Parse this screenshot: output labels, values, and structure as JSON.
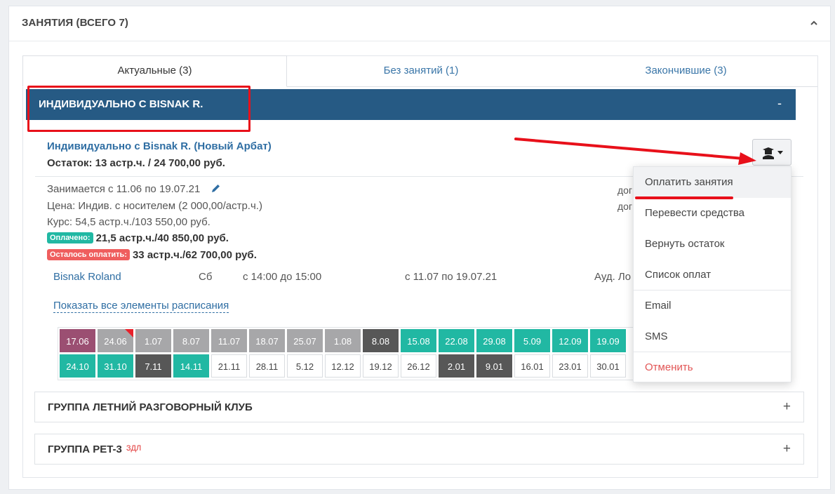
{
  "panel": {
    "title": "ЗАНЯТИЯ (ВСЕГО 7)"
  },
  "tabs": [
    {
      "label": "Актуальные (3)"
    },
    {
      "label": "Без занятий (1)"
    },
    {
      "label": "Закончившие (3)"
    }
  ],
  "group": {
    "title": "ИНДИВИДУАЛЬНО С BISNAK R.",
    "toggle": "-"
  },
  "lesson": {
    "title": "Индивидуально с Bisnak R. (Новый Арбат)",
    "balance": "Остаток: 13 астр.ч. / 24 700,00 руб.",
    "period": "Занимается с 11.06 по 19.07.21",
    "price": "Цена: Индив. с носителем (2 000,00/астр.ч.)",
    "course": "Курс: 54,5 астр.ч./103 550,00 руб.",
    "paid_badge": "Оплачено:",
    "paid_amount": "21,5 астр.ч./40 850,00 руб.",
    "due_badge": "Осталось оплатить:",
    "due_amount": "33 астр.ч./62 700,00 руб.",
    "right_hint_1": "дог",
    "right_hint_2": "дог"
  },
  "schedule": {
    "teacher": "Bisnak Roland",
    "day": "Сб",
    "time": "с 14:00 до 15:00",
    "dates": "с 11.07 по 19.07.21",
    "room": "Ауд. Ло",
    "show_all": "Показать все элементы расписания"
  },
  "calendar": {
    "row1": [
      {
        "d": "17.06",
        "s": "purple"
      },
      {
        "d": "24.06",
        "s": "gray",
        "flag": true
      },
      {
        "d": "1.07",
        "s": "gray"
      },
      {
        "d": "8.07",
        "s": "gray"
      },
      {
        "d": "11.07",
        "s": "gray"
      },
      {
        "d": "18.07",
        "s": "gray"
      },
      {
        "d": "25.07",
        "s": "gray"
      },
      {
        "d": "1.08",
        "s": "gray"
      },
      {
        "d": "8.08",
        "s": "dark"
      },
      {
        "d": "15.08",
        "s": "teal"
      },
      {
        "d": "22.08",
        "s": "teal"
      },
      {
        "d": "29.08",
        "s": "teal"
      },
      {
        "d": "5.09",
        "s": "teal"
      },
      {
        "d": "12.09",
        "s": "teal"
      },
      {
        "d": "19.09",
        "s": "teal"
      }
    ],
    "row2": [
      {
        "d": "24.10",
        "s": "teal"
      },
      {
        "d": "31.10",
        "s": "teal"
      },
      {
        "d": "7.11",
        "s": "dark"
      },
      {
        "d": "14.11",
        "s": "teal"
      },
      {
        "d": "21.11",
        "s": "white"
      },
      {
        "d": "28.11",
        "s": "white"
      },
      {
        "d": "5.12",
        "s": "white"
      },
      {
        "d": "12.12",
        "s": "white"
      },
      {
        "d": "19.12",
        "s": "white"
      },
      {
        "d": "26.12",
        "s": "white"
      },
      {
        "d": "2.01",
        "s": "dark"
      },
      {
        "d": "9.01",
        "s": "dark"
      },
      {
        "d": "16.01",
        "s": "white"
      },
      {
        "d": "23.01",
        "s": "white"
      },
      {
        "d": "30.01",
        "s": "white"
      }
    ],
    "colors": {
      "purple": "#9b4f72",
      "gray": "#a7a7a9",
      "dark": "#575757",
      "teal": "#21b8a3",
      "white": "#ffffff",
      "flag": "#e8212b"
    }
  },
  "other_groups": [
    {
      "title": "ГРУППА ЛЕТНИЙ РАЗГОВОРНЫЙ КЛУБ",
      "tag": "",
      "toggle": "+"
    },
    {
      "title": "ГРУППА PET-3",
      "tag": "ЗДЛ",
      "toggle": "+"
    }
  ],
  "dropdown": {
    "items": [
      "Оплатить занятия",
      "Перевести средства",
      "Вернуть остаток",
      "Список оплат",
      "Email",
      "SMS",
      "Отменить"
    ]
  }
}
